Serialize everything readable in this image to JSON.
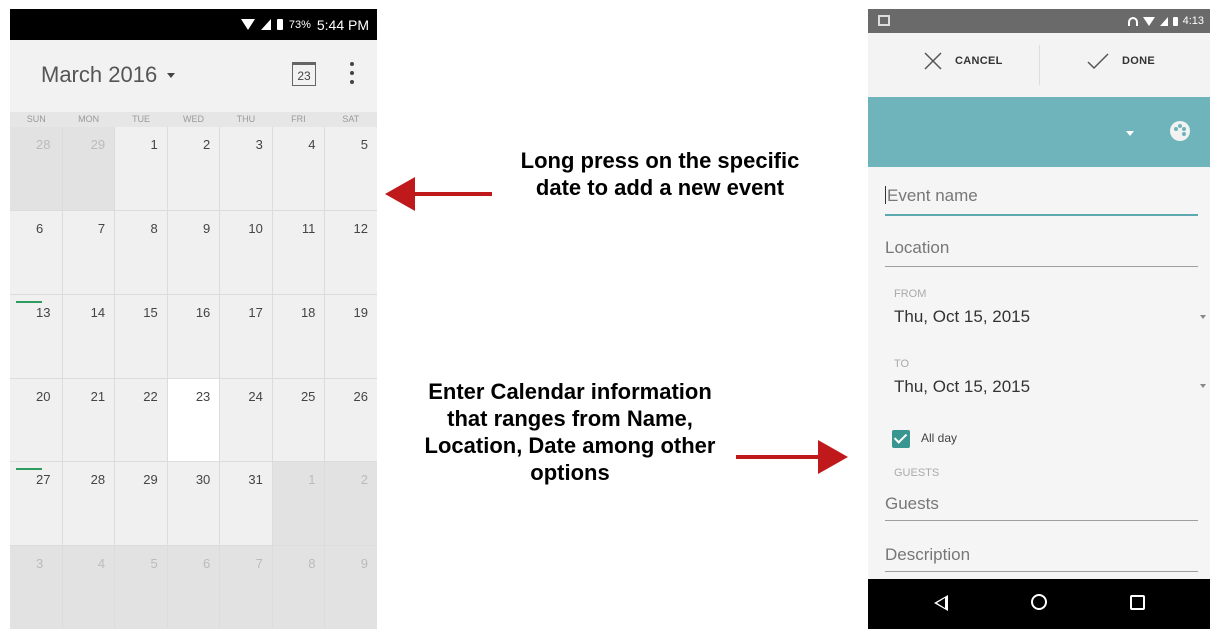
{
  "left_phone": {
    "status_bar": {
      "battery": "73%",
      "time": "5:44 PM"
    },
    "header": {
      "month_title": "March 2016",
      "today_icon_label": "23"
    },
    "weekdays": [
      "SUN",
      "MON",
      "TUE",
      "WED",
      "THU",
      "FRI",
      "SAT"
    ],
    "weeks": [
      [
        "28",
        "29",
        "1",
        "2",
        "3",
        "4",
        "5"
      ],
      [
        "6",
        "7",
        "8",
        "9",
        "10",
        "11",
        "12"
      ],
      [
        "13",
        "14",
        "15",
        "16",
        "17",
        "18",
        "19"
      ],
      [
        "20",
        "21",
        "22",
        "23",
        "24",
        "25",
        "26"
      ],
      [
        "27",
        "28",
        "29",
        "30",
        "31",
        "1",
        "2"
      ],
      [
        "3",
        "4",
        "5",
        "6",
        "7",
        "8",
        "9"
      ]
    ],
    "today": "23",
    "colors": {
      "event_marker": "#2e9b5f"
    }
  },
  "annotations": {
    "top": "Long press on the specific date to add a new event",
    "bottom": "Enter Calendar information that ranges from Name, Location, Date among other options",
    "arrow_color": "#c0191c"
  },
  "right_phone": {
    "status_bar": {
      "time": "4:13"
    },
    "action_bar": {
      "cancel_label": "CANCEL",
      "done_label": "DONE"
    },
    "color_bar": {
      "color": "#6fb4ba"
    },
    "form": {
      "event_name_placeholder": "Event name",
      "location_placeholder": "Location",
      "from_label": "FROM",
      "from_date": "Thu, Oct 15, 2015",
      "to_label": "TO",
      "to_date": "Thu, Oct 15, 2015",
      "all_day_label": "All day",
      "all_day_checked": true,
      "guests_label": "GUESTS",
      "guests_placeholder": "Guests",
      "description_placeholder": "Description"
    },
    "nav_icons": [
      "back-icon",
      "home-icon",
      "recent-apps-icon"
    ]
  }
}
